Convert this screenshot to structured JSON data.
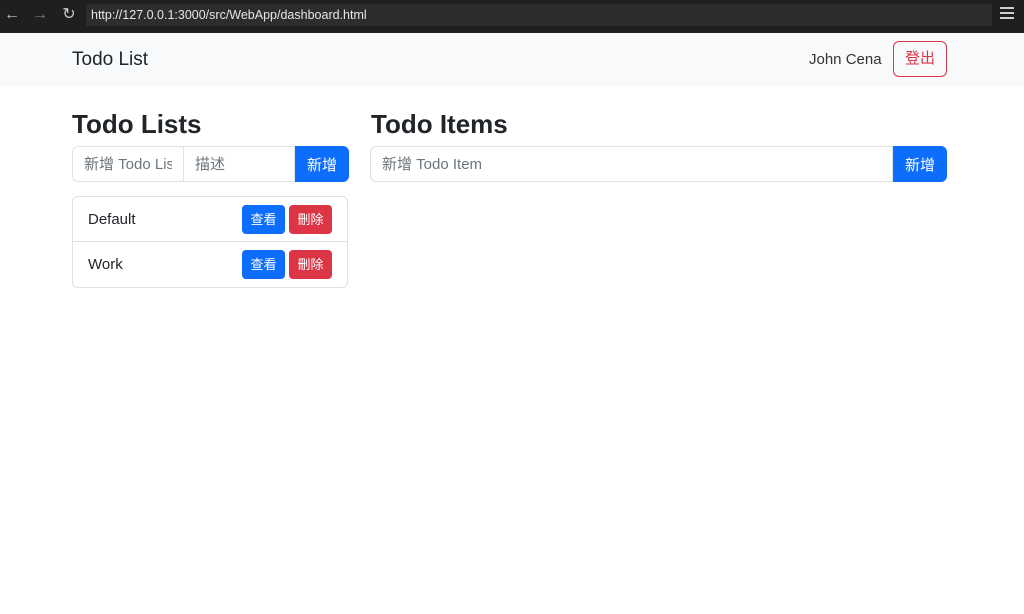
{
  "browser": {
    "url": "http://127.0.0.1:3000/src/WebApp/dashboard.html"
  },
  "navbar": {
    "brand": "Todo List",
    "username": "John Cena",
    "logout_label": "登出"
  },
  "lists_panel": {
    "heading": "Todo Lists",
    "name_placeholder": "新增 Todo List",
    "desc_placeholder": "描述",
    "add_label": "新增",
    "items": [
      {
        "name": "Default",
        "view_label": "查看",
        "delete_label": "刪除"
      },
      {
        "name": "Work",
        "view_label": "查看",
        "delete_label": "刪除"
      }
    ]
  },
  "items_panel": {
    "heading": "Todo Items",
    "input_placeholder": "新增 Todo Item",
    "add_label": "新增"
  },
  "colors": {
    "primary": "#0d6efd",
    "danger": "#dc3545",
    "navbar_bg": "#f8f9fa"
  }
}
